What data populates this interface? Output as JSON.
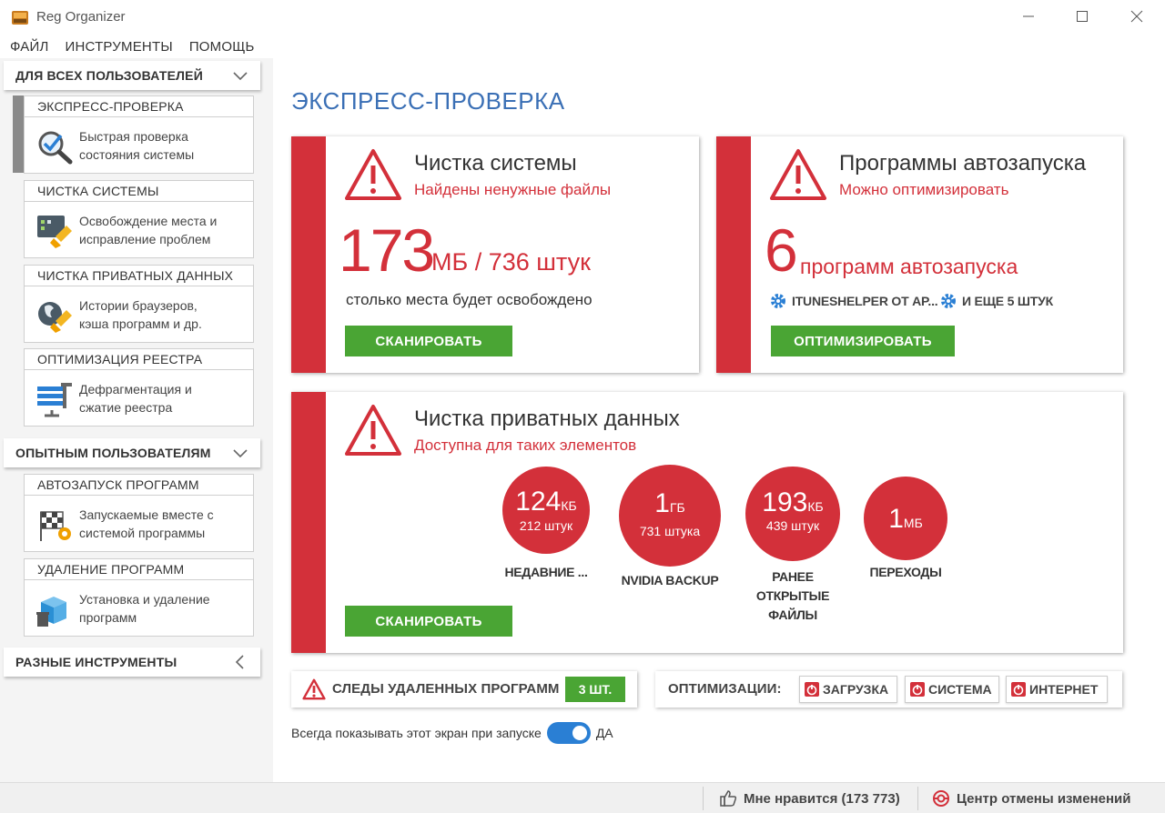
{
  "window": {
    "title": "Reg Organizer"
  },
  "menu": {
    "items": [
      "ФАЙЛ",
      "ИНСТРУМЕНТЫ",
      "ПОМОЩЬ"
    ]
  },
  "sidebar": {
    "sections": [
      {
        "label": "ДЛЯ ВСЕХ ПОЛЬЗОВАТЕЛЕЙ"
      },
      {
        "label": "ОПЫТНЫМ ПОЛЬЗОВАТЕЛЯМ"
      },
      {
        "label": "РАЗНЫЕ ИНСТРУМЕНТЫ"
      }
    ],
    "items": [
      {
        "title": "ЭКСПРЕСС-ПРОВЕРКА",
        "line1": "Быстрая проверка",
        "line2": "состояния системы",
        "icon": "magnifier-check-icon"
      },
      {
        "title": "ЧИСТКА СИСТЕМЫ",
        "line1": "Освобождение места и",
        "line2": "исправление проблем",
        "icon": "broom-window-icon"
      },
      {
        "title": "ЧИСТКА ПРИВАТНЫХ ДАННЫХ",
        "line1": "Истории браузеров,",
        "line2": "кэша программ и др.",
        "icon": "globe-broom-icon"
      },
      {
        "title": "ОПТИМИЗАЦИЯ РЕЕСТРА",
        "line1": "Дефрагментация и",
        "line2": "сжатие реестра",
        "icon": "registry-compress-icon"
      },
      {
        "title": "АВТОЗАПУСК ПРОГРАММ",
        "line1": "Запускаемые вместе с",
        "line2": "системой программы",
        "icon": "flag-gear-icon"
      },
      {
        "title": "УДАЛЕНИЕ ПРОГРАММ",
        "line1": "Установка и удаление",
        "line2": "программ",
        "icon": "box-trash-icon"
      }
    ]
  },
  "main": {
    "title": "ЭКСПРЕСС-ПРОВЕРКА",
    "system_cleanup": {
      "title": "Чистка системы",
      "subtitle": "Найдены ненужные файлы",
      "big_number": "173",
      "unit": "МБ / 736 штук",
      "note": "столько места будет освобождено",
      "button": "СКАНИРОВАТЬ"
    },
    "startup": {
      "title": "Программы автозапуска",
      "subtitle": "Можно оптимизировать",
      "big_number": "6",
      "unit": "программ автозапуска",
      "items": [
        "ITUNESHELPER ОТ AP...",
        "И ЕЩЕ 5 ШТУК"
      ],
      "button": "ОПТИМИЗИРОВАТЬ"
    },
    "private": {
      "title": "Чистка приватных данных",
      "subtitle": "Доступна для таких элементов",
      "circles": [
        {
          "num": "124",
          "unit": "КБ",
          "count": "212 штук",
          "label": "НЕДАВНИЕ ..."
        },
        {
          "num": "1",
          "unit": "ГБ",
          "count": "731 штука",
          "label": "NVIDIA BACKUP"
        },
        {
          "num": "193",
          "unit": "КБ",
          "count": "439 штук",
          "label": "РАНЕЕ ОТКРЫТЫЕ ФАЙЛЫ",
          "label_lines": [
            "РАНЕЕ",
            "ОТКРЫТЫЕ",
            "ФАЙЛЫ"
          ]
        },
        {
          "num": "1",
          "unit": "МБ",
          "count": "",
          "label": "ПЕРЕХОДЫ"
        }
      ],
      "button": "СКАНИРОВАТЬ"
    },
    "traces": {
      "label": "СЛЕДЫ УДАЛЕННЫХ ПРОГРАММ",
      "badge": "3 ШТ."
    },
    "optimizations": {
      "label": "ОПТИМИЗАЦИИ:",
      "buttons": [
        "ЗАГРУЗКА",
        "СИСТЕМА",
        "ИНТЕРНЕТ"
      ]
    },
    "show_on_start": {
      "label": "Всегда показывать этот экран при запуске",
      "state": "ДА"
    }
  },
  "status": {
    "like": "Мне нравится (173 773)",
    "undo": "Центр отмены изменений"
  },
  "colors": {
    "accent_red": "#d3303a",
    "green": "#4aa534",
    "blue_title": "#3a6fb5",
    "toggle_blue": "#2a7fd4"
  }
}
